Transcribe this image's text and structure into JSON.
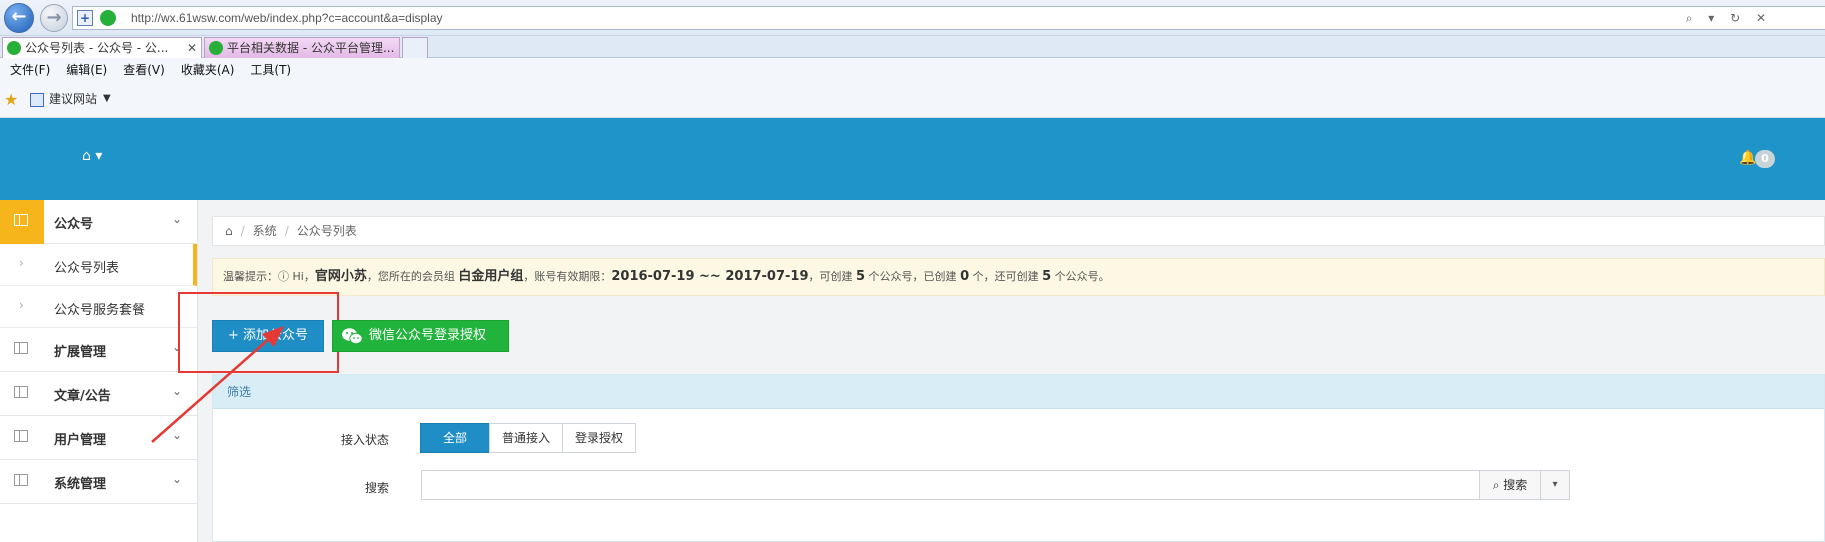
{
  "browser": {
    "url": "http://wx.61wsw.com/web/index.php?c=account&a=display",
    "address_tools": "⌕ ▾ ↻ ✕",
    "tabs": [
      {
        "label": "公众号列表 - 公众号 - 公..."
      },
      {
        "label": "平台相关数据 - 公众平台管理..."
      }
    ],
    "tab_close": "✕",
    "menu": [
      "文件(F)",
      "编辑(E)",
      "查看(V)",
      "收藏夹(A)",
      "工具(T)"
    ],
    "favorites": {
      "site_label": "建议网站"
    }
  },
  "header": {
    "home_menu": "⌂ ▾",
    "notification_count": "0"
  },
  "sidebar": {
    "groups": [
      {
        "label": "公众号",
        "expanded": true,
        "items": [
          {
            "label": "公众号列表",
            "current": true
          },
          {
            "label": "公众号服务套餐"
          }
        ]
      },
      {
        "label": "扩展管理"
      },
      {
        "label": "文章/公告"
      },
      {
        "label": "用户管理"
      },
      {
        "label": "系统管理"
      }
    ]
  },
  "breadcrumb": {
    "home_icon": "⌂",
    "items": [
      "系统",
      "公众号列表"
    ]
  },
  "notice": {
    "prefix": "温馨提示：",
    "greeting": " Hi，",
    "username": "官网小苏",
    "text1": "，您所在的会员组 ",
    "group": "白金用户组",
    "text2": "，账号有效期限：",
    "start_date": "2016-07-19",
    "range_sep": " ~~ ",
    "end_date": "2017-07-19",
    "text3": "，可创建 ",
    "can_create": "5",
    "text4": " 个公众号，已创建 ",
    "created": "0",
    "text5": " 个，还可创建 ",
    "remaining": "5",
    "text6": " 个公众号。"
  },
  "actions": {
    "add_label": "+ 添加公众号",
    "auth_label": "微信公众号登录授权"
  },
  "filter": {
    "title": "筛选",
    "state_label": "接入状态",
    "state_options": [
      "全部",
      "普通接入",
      "登录授权"
    ],
    "state_selected": "全部",
    "search_label": "搜索",
    "search_value": "",
    "search_button": "⌕ 搜索",
    "search_caret": "▾"
  },
  "colors": {
    "header": "#1f94c9",
    "accent_active": "#f6b51b",
    "primary_button": "#1f8dc6",
    "success_button": "#21b43c",
    "annotation": "#e53935"
  }
}
